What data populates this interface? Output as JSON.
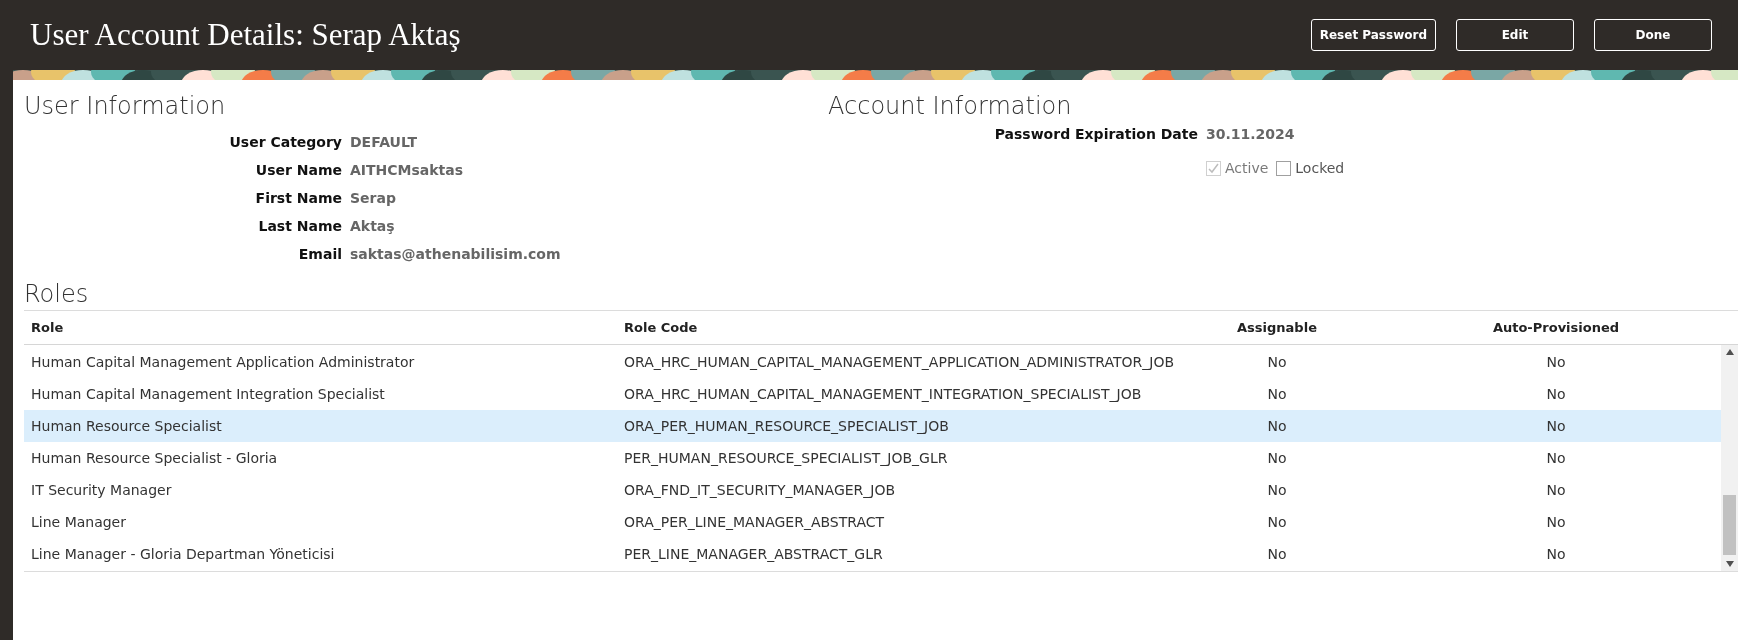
{
  "header": {
    "title": "User Account Details: Serap Aktaş",
    "buttons": [
      "Reset Password",
      "Edit",
      "Done"
    ]
  },
  "user_information": {
    "title": "User Information",
    "fields": [
      {
        "label": "User Category",
        "value": "DEFAULT"
      },
      {
        "label": "User Name",
        "value": "AITHCMsaktas"
      },
      {
        "label": "First Name",
        "value": "Serap"
      },
      {
        "label": "Last Name",
        "value": "Aktaş"
      },
      {
        "label": "Email",
        "value": "saktas@athenabilisim.com"
      }
    ]
  },
  "account_information": {
    "title": "Account Information",
    "fields": [
      {
        "label": "Password Expiration Date",
        "value": "30.11.2024"
      }
    ],
    "checkboxes": [
      {
        "label": "Active",
        "checked": true,
        "disabled": true
      },
      {
        "label": "Locked",
        "checked": false,
        "disabled": false
      }
    ]
  },
  "roles": {
    "title": "Roles",
    "columns": [
      "Role",
      "Role Code",
      "Assignable",
      "Auto-Provisioned"
    ],
    "rows": [
      {
        "role": "Human Capital Management Application Administrator",
        "code": "ORA_HRC_HUMAN_CAPITAL_MANAGEMENT_APPLICATION_ADMINISTRATOR_JOB",
        "assignable": "No",
        "auto": "No",
        "selected": false
      },
      {
        "role": "Human Capital Management Integration Specialist",
        "code": "ORA_HRC_HUMAN_CAPITAL_MANAGEMENT_INTEGRATION_SPECIALIST_JOB",
        "assignable": "No",
        "auto": "No",
        "selected": false
      },
      {
        "role": "Human Resource Specialist",
        "code": "ORA_PER_HUMAN_RESOURCE_SPECIALIST_JOB",
        "assignable": "No",
        "auto": "No",
        "selected": true
      },
      {
        "role": "Human Resource Specialist - Gloria",
        "code": "PER_HUMAN_RESOURCE_SPECIALIST_JOB_GLR",
        "assignable": "No",
        "auto": "No",
        "selected": false
      },
      {
        "role": "IT Security Manager",
        "code": "ORA_FND_IT_SECURITY_MANAGER_JOB",
        "assignable": "No",
        "auto": "No",
        "selected": false
      },
      {
        "role": "Line Manager",
        "code": "ORA_PER_LINE_MANAGER_ABSTRACT",
        "assignable": "No",
        "auto": "No",
        "selected": false
      },
      {
        "role": "Line Manager - Gloria Departman Yöneticisi",
        "code": "PER_LINE_MANAGER_ABSTRACT_GLR",
        "assignable": "No",
        "auto": "No",
        "selected": false
      }
    ]
  }
}
